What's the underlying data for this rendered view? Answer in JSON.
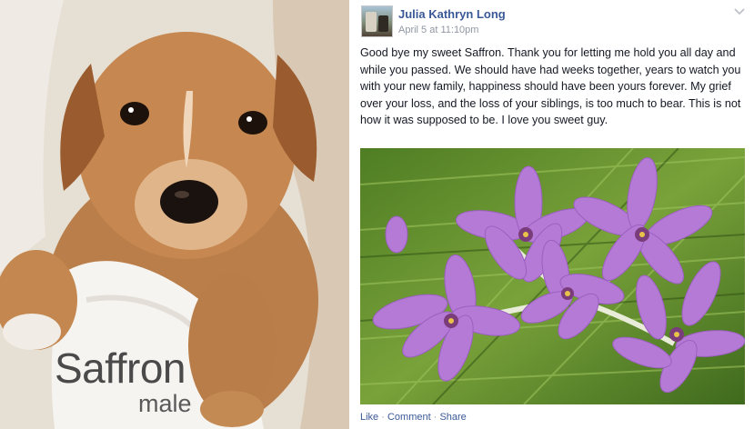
{
  "photo": {
    "caption_name": "Saffron",
    "caption_sub": "male"
  },
  "post": {
    "author": "Julia Kathryn Long",
    "timestamp": "April 5 at 11:10pm",
    "text": "Good bye my sweet Saffron. Thank you for letting me hold you all day and while you passed. We should have had weeks together, years to watch you with your new family, happiness should have been yours forever. My grief over your loss, and the loss of your siblings, is too much to bear. This is not how it was supposed to be. I love you sweet guy.",
    "actions": {
      "like": "Like",
      "comment": "Comment",
      "share": "Share",
      "separator": " · "
    }
  },
  "icons": {
    "options": "chevron-down-icon"
  },
  "colors": {
    "author_link": "#3b5998",
    "meta_gray": "#9197a3",
    "body_text": "#141823",
    "flower_purple": "#b57ad6",
    "grass_green": "#5d8a2c"
  }
}
